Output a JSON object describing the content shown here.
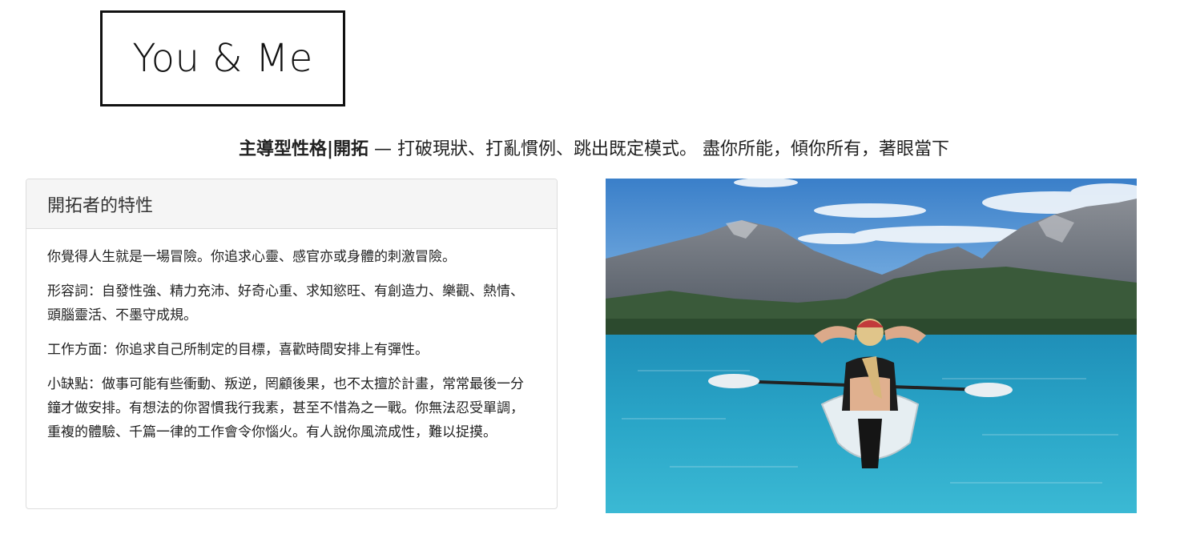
{
  "brand": {
    "logo_text": "You & Me"
  },
  "headline": {
    "type_name": "主導型性格|開拓",
    "dash": " — ",
    "tagline": "打破現狀、打亂慣例、跳出既定模式。 盡你所能，傾你所有，著眼當下"
  },
  "traits_panel": {
    "title": "開拓者的特性",
    "paragraphs": [
      "你覺得人生就是一場冒險。你追求心靈、感官亦或身體的刺激冒險。",
      "形容詞：自發性強、精力充沛、好奇心重、求知慾旺、有創造力、樂觀、熱情、頭腦靈活、不墨守成規。",
      "工作方面：你追求自己所制定的目標，喜歡時間安排上有彈性。",
      "小缺點：做事可能有些衝動、叛逆，罔顧後果，也不太擅於計畫，常常最後一分鐘才做安排。有想法的你習慣我行我素，甚至不惜為之一戰。你無法忍受單調，重複的體驗、千篇一律的工作會令你惱火。有人說你風流成性，難以捉摸。"
    ]
  },
  "colors": {
    "sky": "#3f86cf",
    "lake": "#2aa6c8",
    "mountain": "#5f6670",
    "forest": "#2c4a2e"
  }
}
